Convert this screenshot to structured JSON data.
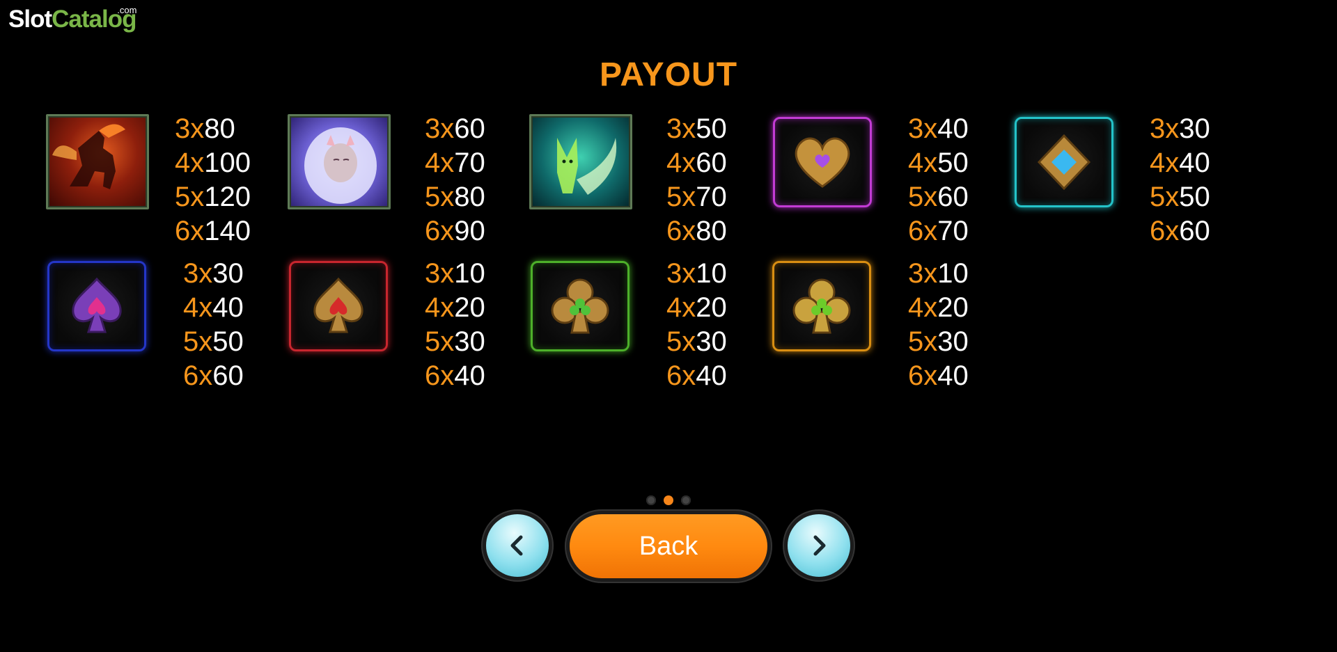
{
  "logo": {
    "slot": "Slot",
    "catalog": "Catalog",
    "com": ".com"
  },
  "title": "PAYOUT",
  "symbols": [
    {
      "name": "fire-pegasus-icon",
      "pays": [
        [
          "3x",
          "80"
        ],
        [
          "4x",
          "100"
        ],
        [
          "5x",
          "120"
        ],
        [
          "6x",
          "140"
        ]
      ]
    },
    {
      "name": "white-lion-icon",
      "pays": [
        [
          "3x",
          "60"
        ],
        [
          "4x",
          "70"
        ],
        [
          "5x",
          "80"
        ],
        [
          "6x",
          "90"
        ]
      ]
    },
    {
      "name": "green-fox-icon",
      "pays": [
        [
          "3x",
          "50"
        ],
        [
          "4x",
          "60"
        ],
        [
          "5x",
          "70"
        ],
        [
          "6x",
          "80"
        ]
      ]
    },
    {
      "name": "heart-icon",
      "color": "#c23bd4",
      "pays": [
        [
          "3x",
          "40"
        ],
        [
          "4x",
          "50"
        ],
        [
          "5x",
          "60"
        ],
        [
          "6x",
          "70"
        ]
      ]
    },
    {
      "name": "diamond-icon",
      "color": "#24c3c9",
      "pays": [
        [
          "3x",
          "30"
        ],
        [
          "4x",
          "40"
        ],
        [
          "5x",
          "50"
        ],
        [
          "6x",
          "60"
        ]
      ]
    },
    {
      "name": "purple-spade-icon",
      "color": "#2436c8",
      "pays": [
        [
          "3x",
          "30"
        ],
        [
          "4x",
          "40"
        ],
        [
          "5x",
          "50"
        ],
        [
          "6x",
          "60"
        ]
      ]
    },
    {
      "name": "gold-spade-icon",
      "color": "#c8262e",
      "pays": [
        [
          "3x",
          "10"
        ],
        [
          "4x",
          "20"
        ],
        [
          "5x",
          "30"
        ],
        [
          "6x",
          "40"
        ]
      ]
    },
    {
      "name": "green-club-icon",
      "color": "#4db02a",
      "pays": [
        [
          "3x",
          "10"
        ],
        [
          "4x",
          "20"
        ],
        [
          "5x",
          "30"
        ],
        [
          "6x",
          "40"
        ]
      ]
    },
    {
      "name": "gold-club-icon",
      "color": "#d98e12",
      "pays": [
        [
          "3x",
          "10"
        ],
        [
          "4x",
          "20"
        ],
        [
          "5x",
          "30"
        ],
        [
          "6x",
          "40"
        ]
      ]
    }
  ],
  "pagination": {
    "pages": 3,
    "current": 2
  },
  "buttons": {
    "back": "Back",
    "prev_icon": "chevron-left-icon",
    "next_icon": "chevron-right-icon"
  },
  "colors": {
    "accent": "#f7961c",
    "button": "#ff8a10",
    "nav": "#8fe0ee"
  }
}
